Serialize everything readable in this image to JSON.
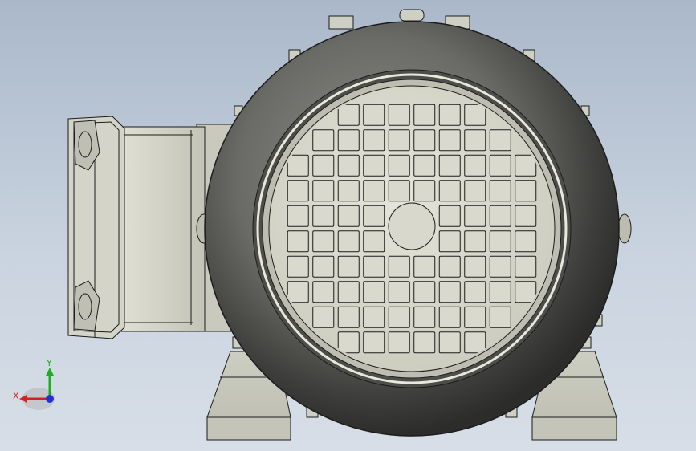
{
  "viewport": {
    "background_top": "#aab8ca",
    "background_bottom": "#d7dee7"
  },
  "model": {
    "type": "electric-motor",
    "view": "front",
    "body_color": "#cfd0c4",
    "fan_cover_color": "#5f5f5c",
    "grille_color": "#d8d8cc",
    "edge_color": "#1c1c1c"
  },
  "triad": {
    "x_label": "X",
    "y_label": "Y",
    "x_color": "#d42020",
    "y_color": "#19b019",
    "z_color": "#2030d8"
  }
}
